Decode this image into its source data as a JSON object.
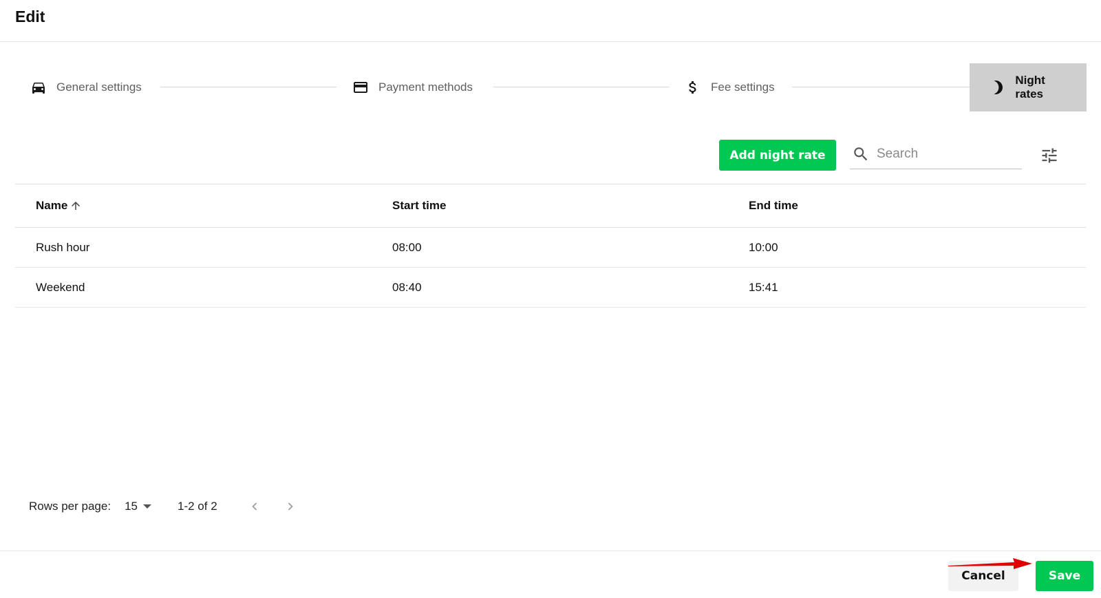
{
  "header": {
    "title": "Edit"
  },
  "stepper": {
    "steps": [
      {
        "label": "General settings",
        "icon": "car-icon"
      },
      {
        "label": "Payment methods",
        "icon": "credit-card-icon"
      },
      {
        "label": "Fee settings",
        "icon": "dollar-icon"
      },
      {
        "label": "Night rates",
        "icon": "moon-icon",
        "active": true
      }
    ]
  },
  "toolbar": {
    "add_label": "Add night rate",
    "search_placeholder": "Search",
    "filter_icon": "tune-icon"
  },
  "table": {
    "columns": [
      "Name",
      "Start time",
      "End time"
    ],
    "sort_column": "Name",
    "sort_direction": "ascending",
    "rows": [
      {
        "name": "Rush hour",
        "start": "08:00",
        "end": "10:00"
      },
      {
        "name": "Weekend",
        "start": "08:40",
        "end": "15:41"
      }
    ]
  },
  "pagination": {
    "rows_per_page_label": "Rows per page:",
    "rows_per_page_value": "15",
    "range": "1-2 of 2"
  },
  "footer": {
    "cancel_label": "Cancel",
    "save_label": "Save"
  },
  "colors": {
    "accent": "#00c853",
    "active_step_bg": "#cfcfcf",
    "annotation_arrow": "#e00000"
  }
}
